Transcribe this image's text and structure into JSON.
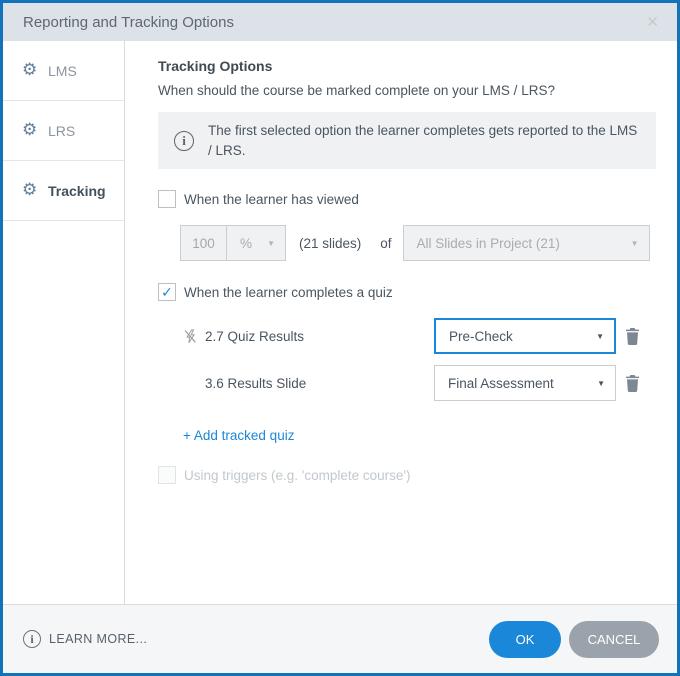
{
  "dialog": {
    "title": "Reporting and Tracking Options"
  },
  "icons": {
    "close": "✕",
    "gear": "⚙",
    "caret": "▼",
    "check": "✓",
    "info": "i"
  },
  "sidebar": {
    "items": [
      {
        "label": "LMS"
      },
      {
        "label": "LRS"
      },
      {
        "label": "Tracking"
      }
    ],
    "selected": "Tracking"
  },
  "content": {
    "heading": "Tracking Options",
    "question": "When should the course be marked complete on your LMS / LRS?",
    "info_text": "The first selected option the learner completes gets reported to the LMS / LRS.",
    "viewed": {
      "label": "When the learner has viewed",
      "checked": false,
      "percent_value": "100",
      "unit_value": "%",
      "slides_note": "(21 slides)",
      "of_label": "of",
      "scope_value": "All Slides in Project (21)"
    },
    "quiz": {
      "label": "When the learner completes a quiz",
      "checked": true,
      "rows": [
        {
          "slide": "2.7 Quiz Results",
          "selection": "Pre-Check"
        },
        {
          "slide": "3.6 Results Slide",
          "selection": "Final Assessment"
        }
      ],
      "add_link": "+ Add tracked quiz"
    },
    "triggers": {
      "label": "Using triggers (e.g. 'complete course')",
      "checked": false,
      "disabled": true
    }
  },
  "footer": {
    "learn_more": "LEARN MORE...",
    "ok": "OK",
    "cancel": "CANCEL"
  },
  "colors": {
    "accent": "#1b87d8",
    "dialog_border": "#1273bb",
    "titlebar_bg": "#dce2e8",
    "ok_button": "#1b87d8",
    "cancel_button": "#9aa3ab"
  }
}
